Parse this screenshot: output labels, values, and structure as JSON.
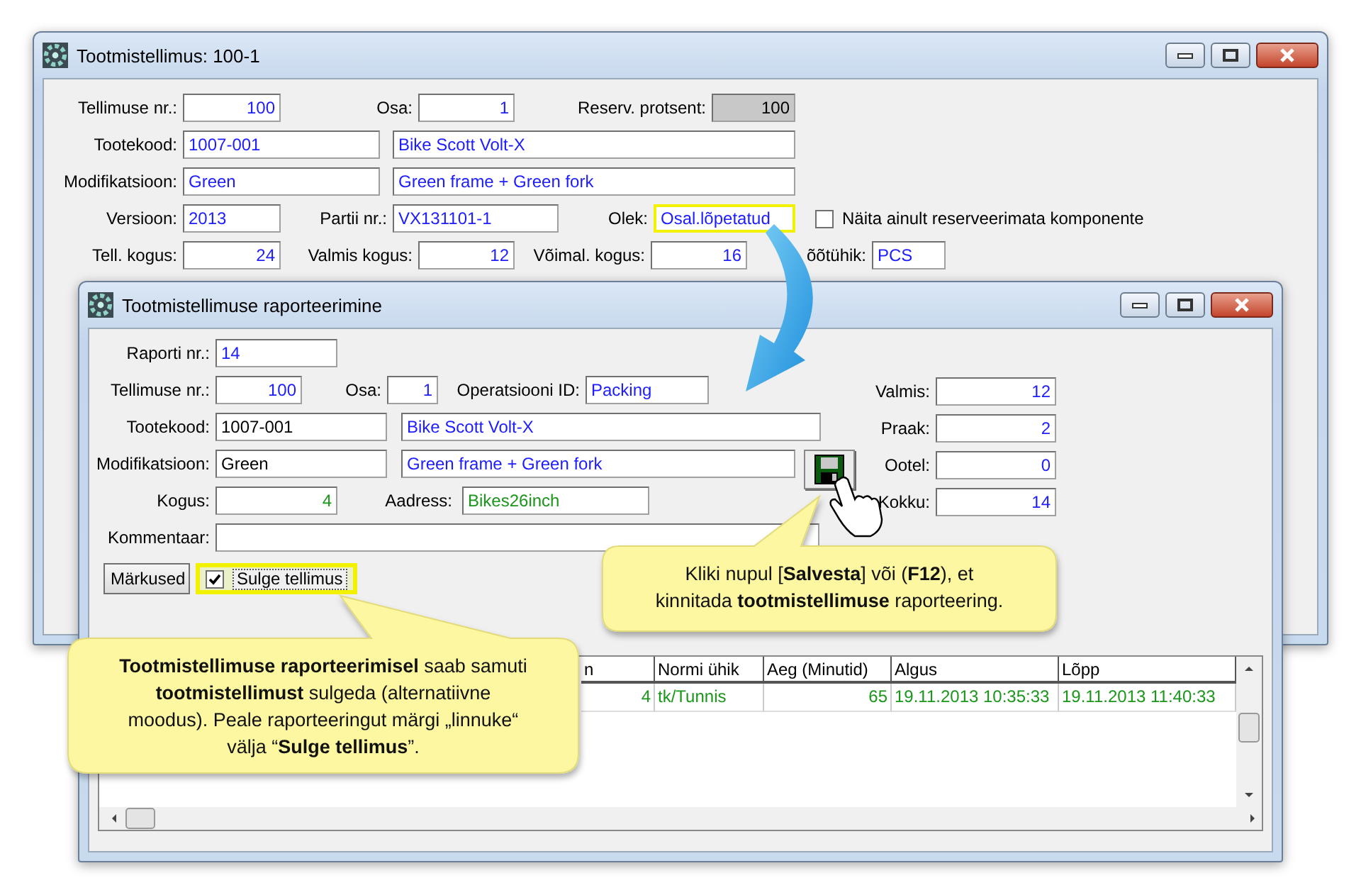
{
  "main_window": {
    "title": "Tootmistellimus: 100-1",
    "rows": [
      [
        {
          "kind": "number",
          "label": "Tellimuse nr.:",
          "value": "100",
          "color": "#1c1cff",
          "highlighted": false
        },
        {
          "kind": "number",
          "label": "Osa:",
          "value": "1",
          "color": "#1c1cff",
          "highlighted": false
        },
        {
          "kind": "locked",
          "label": "Reserv. protsent:",
          "value": "100",
          "color": "#000000",
          "highlighted": false
        }
      ],
      [
        {
          "kind": "text",
          "label": "Tootekood:",
          "value": "1007-001",
          "color": "#1c1cff",
          "highlighted": false
        },
        {
          "kind": "text",
          "value": "Bike Scott Volt-X",
          "color": "#1c1cff",
          "highlighted": false
        }
      ],
      [
        {
          "kind": "text",
          "label": "Modifikatsioon:",
          "value": "Green",
          "color": "#1c1cff",
          "highlighted": false
        },
        {
          "kind": "text",
          "value": "Green frame + Green fork",
          "color": "#1c1cff",
          "highlighted": false
        }
      ],
      [
        {
          "kind": "text",
          "label": "Versioon:",
          "value": "2013",
          "color": "#1c1cff",
          "highlighted": false
        },
        {
          "kind": "text",
          "label": "Partii nr.:",
          "value": "VX131101-1",
          "color": "#1c1cff",
          "highlighted": false
        },
        {
          "kind": "text",
          "label": "Olek:",
          "value": "Osal.lõpetatud",
          "color": "#1c1cff",
          "highlighted": true
        },
        {
          "kind": "checkbox",
          "label": "Näita ainult reserveerimata komponente",
          "checked": false,
          "highlighted": false
        }
      ],
      [
        {
          "kind": "number",
          "label": "Tell. kogus:",
          "value": "24",
          "color": "#1c1cff",
          "highlighted": false
        },
        {
          "kind": "number",
          "label": "Valmis kogus:",
          "value": "12",
          "color": "#1c1cff",
          "highlighted": false
        },
        {
          "kind": "number",
          "label": "Võimal. kogus:",
          "value": "16",
          "color": "#1c1cff",
          "highlighted": false
        },
        {
          "kind": "text",
          "label": "õõtühik:",
          "value": "PCS",
          "color": "#1c1cff",
          "highlighted": false
        }
      ]
    ]
  },
  "report_window": {
    "title": "Tootmistellimuse raporteerimine",
    "rows": [
      [
        {
          "kind": "text",
          "label": "Raporti nr.:",
          "value": "14",
          "color": "#1c1cff",
          "highlighted": false
        }
      ],
      [
        {
          "kind": "number",
          "label": "Tellimuse nr.:",
          "value": "100",
          "color": "#1c1cff",
          "highlighted": false
        },
        {
          "kind": "number",
          "label": "Osa:",
          "value": "1",
          "color": "#1c1cff",
          "highlighted": false
        },
        {
          "kind": "text",
          "label": "Operatsiooni ID:",
          "value": "Packing",
          "color": "#1c1cff",
          "highlighted": false
        }
      ],
      [
        {
          "kind": "text",
          "label": "Tootekood:",
          "value": "1007-001",
          "color": "#000000",
          "highlighted": false
        },
        {
          "kind": "text",
          "value": "Bike Scott Volt-X",
          "color": "#1c1cff",
          "highlighted": false
        }
      ],
      [
        {
          "kind": "text",
          "label": "Modifikatsioon:",
          "value": "Green",
          "color": "#000000",
          "highlighted": false
        },
        {
          "kind": "text",
          "value": "Green frame + Green fork",
          "color": "#1c1cff",
          "highlighted": false
        },
        {
          "kind": "save"
        }
      ],
      [
        {
          "kind": "number",
          "label": "Kogus:",
          "value": "4",
          "color": "#1a961a",
          "highlighted": false
        },
        {
          "kind": "text",
          "label": "Aadress:",
          "value": "Bikes26inch",
          "color": "#1a961a",
          "highlighted": false
        }
      ],
      [
        {
          "kind": "text",
          "label": "Kommentaar:",
          "highlighted": false
        }
      ],
      [
        {
          "kind": "button",
          "label": "Märkused"
        },
        {
          "kind": "checkbox",
          "label": "Sulge tellimus",
          "checked": true,
          "highlighted": true
        }
      ]
    ],
    "side_fields": [
      {
        "label": "Valmis:",
        "value": "12"
      },
      {
        "label": "Praak:",
        "value": "2"
      },
      {
        "label": "Ootel:",
        "value": "0"
      },
      {
        "label": "Kokku:",
        "value": "14"
      }
    ],
    "table": {
      "columns": [
        {
          "label": "n",
          "kind": "number"
        },
        {
          "label": "Normi ühik",
          "kind": "text"
        },
        {
          "label": "Aeg (Minutid)",
          "kind": "number"
        },
        {
          "label": "Algus",
          "kind": "text"
        },
        {
          "label": "Lõpp",
          "kind": "text"
        }
      ],
      "rows": [
        {
          "cells": [
            "4",
            "tk/Tunnis",
            "65",
            "19.11.2013 10:35:33",
            "19.11.2013 11:40:33"
          ]
        }
      ]
    }
  },
  "callouts": [
    {
      "text": "Kliki nupul [**Salvesta**] või (**F12**), et kinnitada **tootmistellimuse** raporteering."
    },
    {
      "text": "**Tootmistellimuse raporteerimisel** saab samuti **tootmistellimust** sulgeda (alternatiivne moodus).  Peale raporteeringut märgi „linnuke“ välja “**Sulge tellimus**”."
    }
  ]
}
